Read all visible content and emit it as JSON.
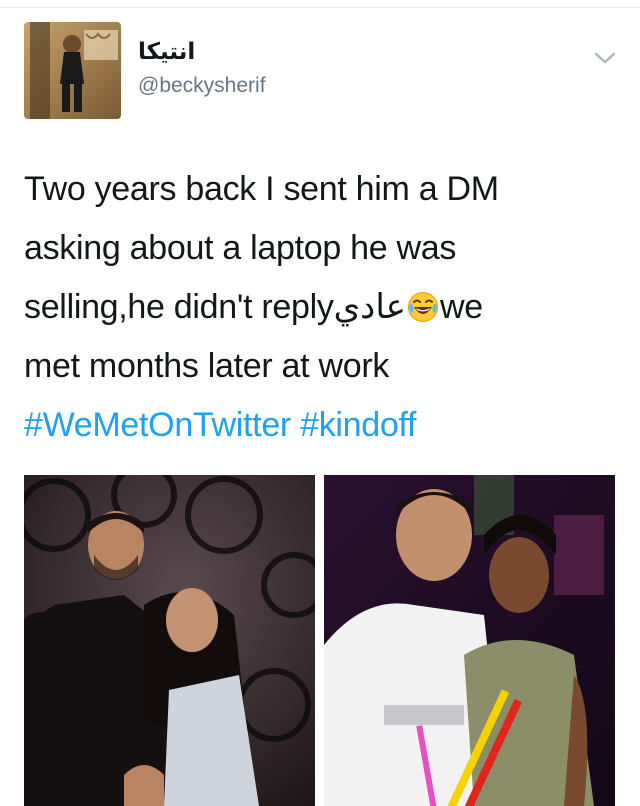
{
  "user": {
    "display_name": "انتيكا",
    "handle": "@beckysherif",
    "avatar_icon": "user-avatar-photo"
  },
  "tweet": {
    "line1": "Two years back I sent him a DM",
    "line2": "asking about a laptop he was",
    "line3_pre": "selling,he didn't reply",
    "line3_arabic": "عادي",
    "line3_emoji": "face-with-tears-of-joy-icon",
    "line3_post": "we",
    "line4": "met months later at work",
    "hashtag1": "#WeMetOnTwitter",
    "hashtag2": "#kindoff"
  },
  "colors": {
    "link": "#1da1f2",
    "text": "#14171a",
    "secondary": "#657786"
  },
  "menu": {
    "chevron_icon": "chevron-down-icon"
  }
}
